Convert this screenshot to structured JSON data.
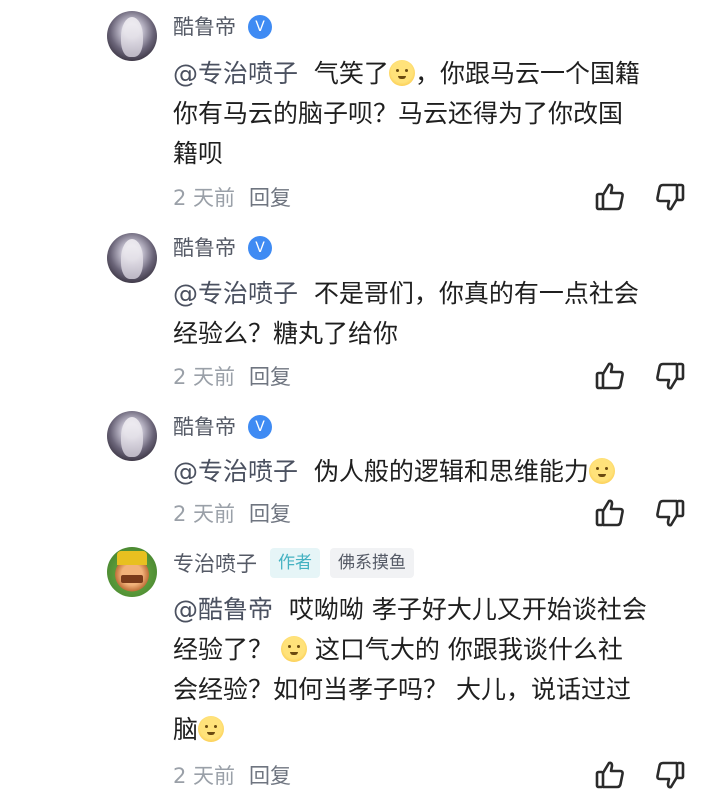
{
  "comments": [
    {
      "user": "酷鲁帝",
      "badge_icon": "verified-v-icon",
      "mention": "@专治喷子",
      "text_parts": [
        "气笑了",
        "，你跟马云一个国籍",
        "你有马云的脑子呗？马云还得为了你改国",
        "籍呗"
      ],
      "time": "2 天前",
      "reply_label": "回复"
    },
    {
      "user": "酷鲁帝",
      "badge_icon": "verified-v-icon",
      "mention": "@专治喷子",
      "text_parts": [
        "不是哥们，你真的有一点社会",
        "经验么？糖丸了给你"
      ],
      "time": "2 天前",
      "reply_label": "回复"
    },
    {
      "user": "酷鲁帝",
      "badge_icon": "verified-v-icon",
      "mention": "@专治喷子",
      "text_parts": [
        "伪人般的逻辑和思维能力"
      ],
      "time": "2 天前",
      "reply_label": "回复"
    },
    {
      "user": "专治喷子",
      "tag_author": "作者",
      "tag_fan": "佛系摸鱼",
      "mention": "@酷鲁帝",
      "text_parts": [
        "哎呦呦 孝子好大儿又开始谈社会",
        "经验了？",
        " 这口气大的 你跟我谈什么社",
        "会经验？如何当孝子吗？ 大儿，说话过过",
        "脑"
      ],
      "time": "2 天前",
      "reply_label": "回复"
    }
  ],
  "icons": {
    "like": "thumbs-up-icon",
    "dislike": "thumbs-down-icon",
    "emoji": "smile-emoji-icon"
  }
}
